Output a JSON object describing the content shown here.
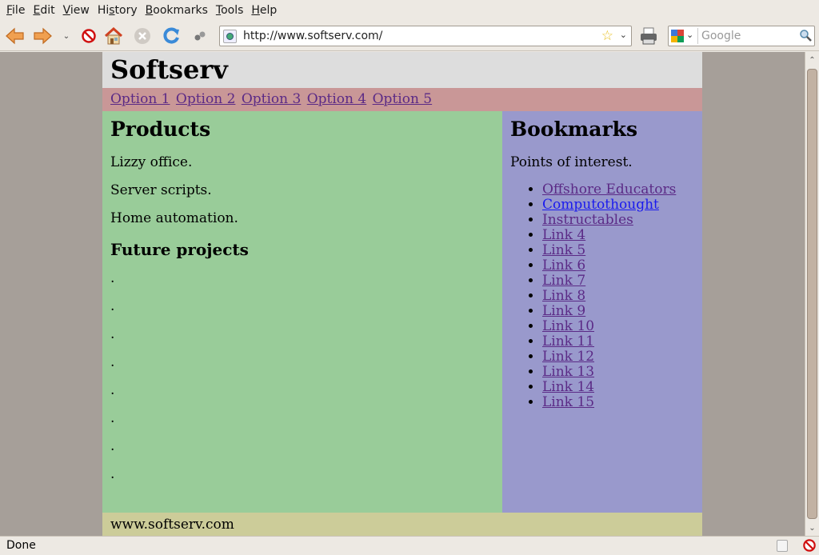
{
  "menubar": {
    "items": [
      {
        "label": "File",
        "mnemonic": "F",
        "rest": "ile"
      },
      {
        "label": "Edit",
        "mnemonic": "E",
        "rest": "dit"
      },
      {
        "label": "View",
        "mnemonic": "V",
        "rest": "iew"
      },
      {
        "label": "History",
        "pre": "Hi",
        "mnemonic": "s",
        "rest": "tory"
      },
      {
        "label": "Bookmarks",
        "mnemonic": "B",
        "rest": "ookmarks"
      },
      {
        "label": "Tools",
        "mnemonic": "T",
        "rest": "ools"
      },
      {
        "label": "Help",
        "mnemonic": "H",
        "rest": "elp"
      }
    ]
  },
  "toolbar": {
    "url": "http://www.softserv.com/",
    "search_placeholder": "Google",
    "icons": [
      "back-icon",
      "forward-icon",
      "history-dropdown-icon",
      "adblock-icon",
      "home-icon",
      "stop-icon",
      "reload-icon",
      "extension-icon",
      "print-icon"
    ]
  },
  "site": {
    "title": "Softserv",
    "nav": [
      "Option 1",
      "Option 2",
      "Option 3",
      "Option 4",
      "Option 5"
    ],
    "main": {
      "heading": "Products",
      "items": [
        "Lizzy office.",
        "Server scripts.",
        "Home automation."
      ],
      "subheading": "Future projects",
      "placeholders": [
        ".",
        ".",
        ".",
        ".",
        ".",
        ".",
        ".",
        "."
      ]
    },
    "sidebar": {
      "heading": "Bookmarks",
      "intro": "Points of interest.",
      "links": [
        {
          "label": "Offshore Educators",
          "visited": true
        },
        {
          "label": "Computothought",
          "visited": false
        },
        {
          "label": "Instructables",
          "visited": true
        },
        {
          "label": "Link 4",
          "visited": true
        },
        {
          "label": "Link 5",
          "visited": true
        },
        {
          "label": "Link 6",
          "visited": true
        },
        {
          "label": "Link 7",
          "visited": true
        },
        {
          "label": "Link 8",
          "visited": true
        },
        {
          "label": "Link 9",
          "visited": true
        },
        {
          "label": "Link 10",
          "visited": true
        },
        {
          "label": "Link 11",
          "visited": true
        },
        {
          "label": "Link 12",
          "visited": true
        },
        {
          "label": "Link 13",
          "visited": true
        },
        {
          "label": "Link 14",
          "visited": true
        },
        {
          "label": "Link 15",
          "visited": true
        }
      ]
    },
    "footer": "www.softserv.com"
  },
  "status": {
    "text": "Done"
  },
  "colors": {
    "header": "#dddddd",
    "nav": "#c99797",
    "main": "#99cc99",
    "sidebar": "#9999cc",
    "footer": "#cccc99",
    "visited_link": "#5b2a86",
    "link": "#1a1aee"
  }
}
